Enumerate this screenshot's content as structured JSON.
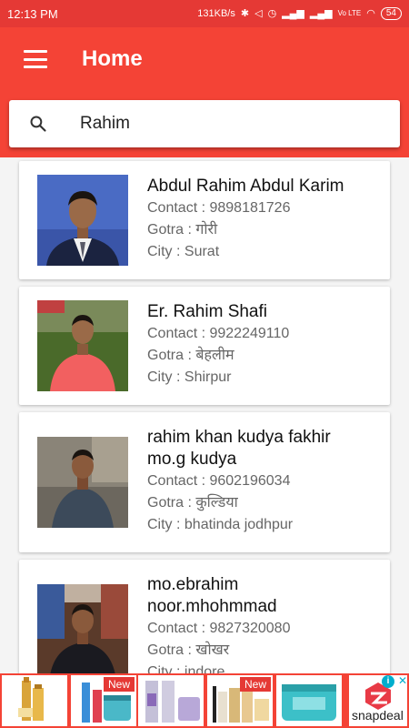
{
  "status_bar": {
    "time": "12:13 PM",
    "speed": "131KB/s",
    "network": "Vo LTE",
    "battery": "54"
  },
  "app_bar": {
    "title": "Home"
  },
  "search": {
    "value": "Rahim",
    "placeholder": ""
  },
  "contacts": [
    {
      "name_lines": [
        "Abdul Rahim Abdul Karim"
      ],
      "contact": "Contact : 9898181726",
      "gotra": "Gotra : गोरी",
      "city": "City : Surat"
    },
    {
      "name_lines": [
        "Er. Rahim Shafi"
      ],
      "contact": "Contact : 9922249110",
      "gotra": "Gotra : बेहलीम",
      "city": "City : Shirpur"
    },
    {
      "name_lines": [
        "rahim khan kudya fakhir",
        "mo.g kudya"
      ],
      "contact": "Contact : 9602196034",
      "gotra": "Gotra : कुल्डिया",
      "city": "City : bhatinda jodhpur"
    },
    {
      "name_lines": [
        "mo.ebrahim",
        "noor.mhohmmad"
      ],
      "contact": "Contact : 9827320080",
      "gotra": "Gotra : खोखर",
      "city": "City : indore"
    }
  ],
  "ads": {
    "badges": [
      "New",
      "New"
    ],
    "brand": "snapdeal",
    "info_icon": "i",
    "close_icon": "✕"
  },
  "colors": {
    "primary": "#f44336",
    "status": "#e53935",
    "card": "#ffffff"
  }
}
